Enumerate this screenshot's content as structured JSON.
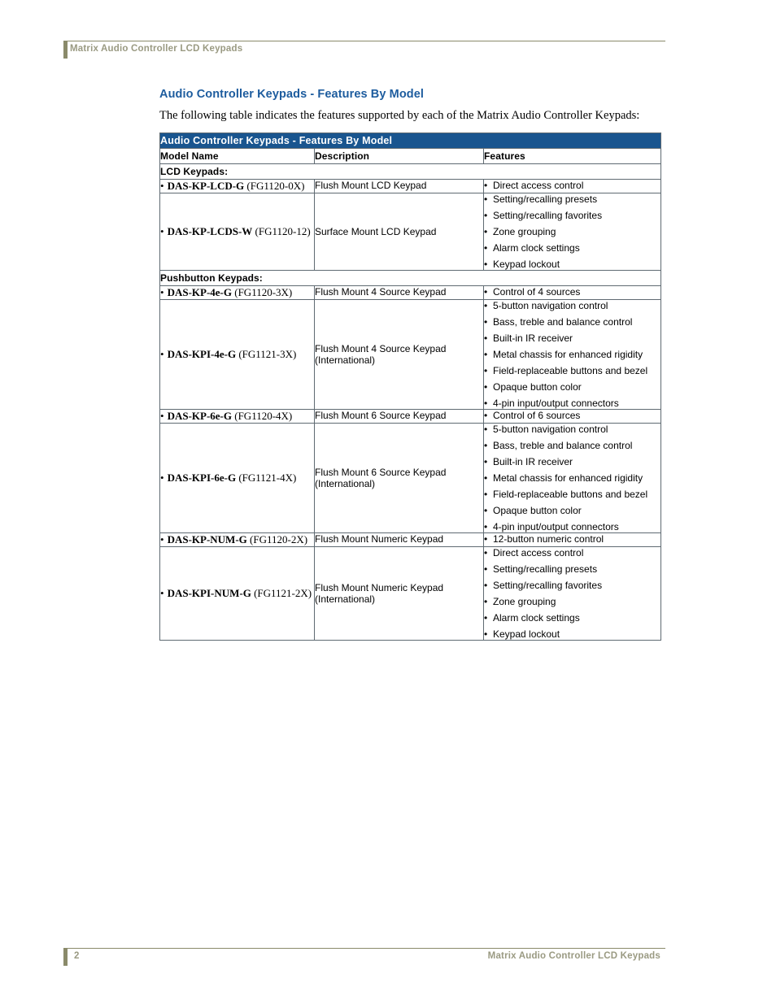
{
  "header": {
    "running_head": "Matrix Audio Controller LCD Keypads"
  },
  "footer": {
    "page_number": "2",
    "running_title": "Matrix Audio Controller LCD Keypads"
  },
  "section": {
    "title": "Audio Controller Keypads - Features By Model",
    "intro": "The following table indicates the features supported by each of the Matrix Audio Controller Keypads:"
  },
  "table": {
    "caption": "Audio Controller Keypads - Features By Model",
    "columns": [
      "Model Name",
      "Description",
      "Features"
    ],
    "groups": [
      {
        "label": "LCD Keypads:"
      },
      {
        "label": "Pushbutton Keypads:"
      }
    ],
    "rows": [
      {
        "model_bold": "DAS-KP-LCD-G",
        "model_code": "(FG1120-0X)",
        "description": "Flush Mount LCD Keypad",
        "features": [
          "Direct access control"
        ]
      },
      {
        "model_bold": "DAS-KP-LCDS-W",
        "model_code": "(FG1120-12)",
        "description": "Surface Mount LCD Keypad",
        "features": [
          "Setting/recalling presets",
          "Setting/recalling favorites",
          "Zone grouping",
          "Alarm clock settings",
          "Keypad lockout"
        ]
      },
      {
        "model_bold": "DAS-KP-4e-G",
        "model_code": "(FG1120-3X)",
        "description": "Flush Mount 4 Source Keypad",
        "features": [
          "Control of 4 sources"
        ]
      },
      {
        "model_bold": "DAS-KPI-4e-G",
        "model_code": "(FG1121-3X)",
        "description": "Flush Mount 4 Source Keypad (International)",
        "features": [
          "5-button navigation control",
          "Bass, treble and balance control",
          "Built-in IR receiver",
          "Metal chassis for enhanced rigidity",
          "Field-replaceable buttons and bezel",
          "Opaque button color",
          "4-pin input/output connectors"
        ]
      },
      {
        "model_bold": "DAS-KP-6e-G",
        "model_code": "(FG1120-4X)",
        "description": "Flush Mount 6 Source Keypad",
        "features": [
          "Control of 6 sources"
        ]
      },
      {
        "model_bold": "DAS-KPI-6e-G",
        "model_code": "(FG1121-4X)",
        "description": "Flush Mount 6 Source Keypad (International)",
        "features": [
          "5-button navigation control",
          "Bass, treble and balance control",
          "Built-in IR receiver",
          "Metal chassis for enhanced rigidity",
          "Field-replaceable buttons and bezel",
          "Opaque button color",
          "4-pin input/output connectors"
        ]
      },
      {
        "model_bold": "DAS-KP-NUM-G",
        "model_code": "(FG1120-2X)",
        "description": "Flush Mount Numeric Keypad",
        "features": [
          "12-button numeric control"
        ]
      },
      {
        "model_bold": "DAS-KPI-NUM-G",
        "model_code": "(FG1121-2X)",
        "description": "Flush Mount Numeric Keypad (International)",
        "features": [
          "Direct access control",
          "Setting/recalling presets",
          "Setting/recalling favorites",
          "Zone grouping",
          "Alarm clock settings",
          "Keypad lockout"
        ]
      }
    ]
  },
  "colors": {
    "heading": "#1d5c9e",
    "table_caption_bg": "#19558f",
    "rule": "#8a8a6a",
    "running_text": "#9a9a82"
  }
}
